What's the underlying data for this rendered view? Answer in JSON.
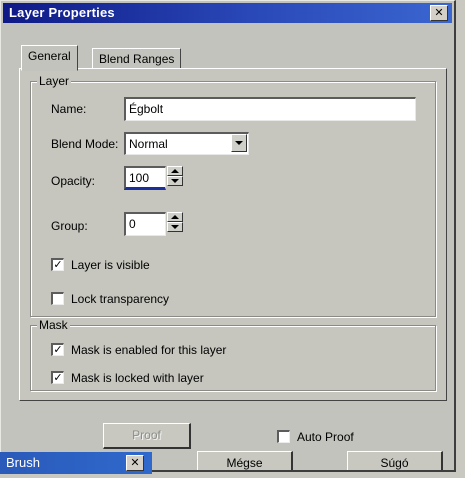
{
  "window": {
    "title": "Layer Properties",
    "close_glyph": "✕"
  },
  "tabs": [
    {
      "label": "General",
      "selected": true
    },
    {
      "label": "Blend Ranges",
      "selected": false
    }
  ],
  "layer_group": {
    "legend": "Layer",
    "name": {
      "label": "Name:",
      "value": "Égbolt"
    },
    "blend_mode": {
      "label": "Blend Mode:",
      "value": "Normal"
    },
    "opacity": {
      "label": "Opacity:",
      "value": "100"
    },
    "group": {
      "label": "Group:",
      "value": "0"
    },
    "visible": {
      "label": "Layer is visible",
      "checked": true
    },
    "lock_transparency": {
      "label": "Lock transparency",
      "checked": false
    }
  },
  "mask_group": {
    "legend": "Mask",
    "enabled": {
      "label": "Mask is enabled for this layer",
      "checked": true
    },
    "locked": {
      "label": "Mask is locked with layer",
      "checked": true
    }
  },
  "bottom": {
    "proof": "Proof",
    "auto_proof": {
      "label": "Auto Proof",
      "checked": false
    },
    "cancel": "Mégse",
    "help": "Súgó"
  },
  "brush_window": {
    "title": "Brush",
    "close_glyph": "✕"
  },
  "check_glyph": "✓",
  "colors": {
    "title_bar": "#0e1a86",
    "brush_bar": "#2a5aba",
    "dialog_face": "#c3c3bd"
  }
}
